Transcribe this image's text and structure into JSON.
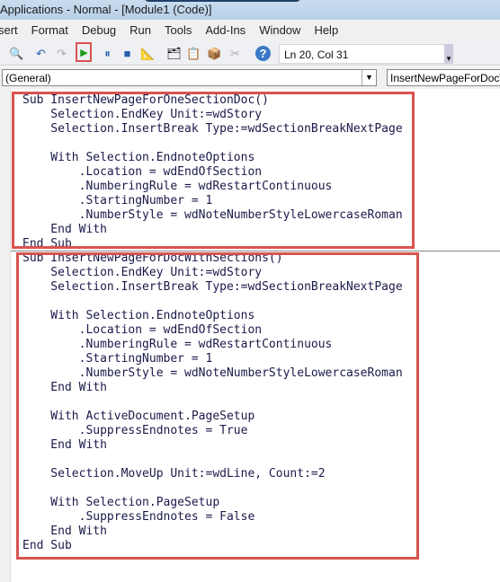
{
  "title": "Applications - Normal - [Module1 (Code)]",
  "menu": [
    "sert",
    "Format",
    "Debug",
    "Run",
    "Tools",
    "Add-Ins",
    "Window",
    "Help"
  ],
  "status": "Ln 20, Col 31",
  "object_combo": "(General)",
  "proc_combo": "InsertNewPageForDocWithSections",
  "proc1": [
    "Sub InsertNewPageForOneSectionDoc()",
    "    Selection.EndKey Unit:=wdStory",
    "    Selection.InsertBreak Type:=wdSectionBreakNextPage",
    "",
    "    With Selection.EndnoteOptions",
    "        .Location = wdEndOfSection",
    "        .NumberingRule = wdRestartContinuous",
    "        .StartingNumber = 1",
    "        .NumberStyle = wdNoteNumberStyleLowercaseRoman",
    "    End With",
    "End Sub"
  ],
  "proc2": [
    "Sub InsertNewPageForDocWithSections()",
    "    Selection.EndKey Unit:=wdStory",
    "    Selection.InsertBreak Type:=wdSectionBreakNextPage",
    "",
    "    With Selection.EndnoteOptions",
    "        .Location = wdEndOfSection",
    "        .NumberingRule = wdRestartContinuous",
    "        .StartingNumber = 1",
    "        .NumberStyle = wdNoteNumberStyleLowercaseRoman",
    "    End With",
    "",
    "    With ActiveDocument.PageSetup",
    "        .SuppressEndnotes = True",
    "    End With",
    "",
    "    Selection.MoveUp Unit:=wdLine, Count:=2",
    "",
    "    With Selection.PageSetup",
    "        .SuppressEndnotes = False",
    "    End With",
    "End Sub"
  ]
}
